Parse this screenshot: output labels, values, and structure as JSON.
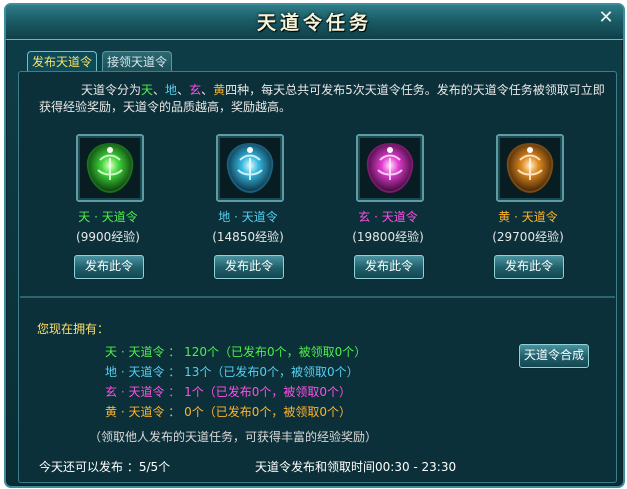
{
  "window": {
    "title": "天道令任务",
    "close_glyph": "✕"
  },
  "tabs": [
    {
      "label": "发布天道令",
      "active": true
    },
    {
      "label": "接领天道令",
      "active": false
    }
  ],
  "intro": {
    "lead": "天道令分为",
    "tian": "天",
    "sep1": "、",
    "di": "地",
    "sep2": "、",
    "xuan": "玄",
    "sep3": "、",
    "huang": "黄",
    "rest": "四种，每天总共可发布5次天道令任务。发布的天道令任务被领取可立即获得经验奖励，天道令的品质越高，奖励越高。"
  },
  "tokens": [
    {
      "name": "天 · 天道令",
      "exp": "(9900经验)",
      "button": "发布此令",
      "icon": "green-token-icon",
      "color": "#4cf04a"
    },
    {
      "name": "地 · 天道令",
      "exp": "(14850经验)",
      "button": "发布此令",
      "icon": "blue-token-icon",
      "color": "#55cff2"
    },
    {
      "name": "玄 · 天道令",
      "exp": "(19800经验)",
      "button": "发布此令",
      "icon": "magenta-token-icon",
      "color": "#ff4fe8"
    },
    {
      "name": "黄 · 天道令",
      "exp": "(29700经验)",
      "button": "发布此令",
      "icon": "orange-token-icon",
      "color": "#ffb42b"
    }
  ],
  "holdings": {
    "title": "您现在拥有：",
    "rows": [
      "天 · 天道令 ： 120个（已发布0个，被领取0个）",
      "地 · 天道令 ： 13个（已发布0个，被领取0个）",
      "玄 · 天道令 ： 1个（已发布0个，被领取0个）",
      "黄 · 天道令 ： 0个（已发布0个，被领取0个）"
    ],
    "merge_button": "天道令合成"
  },
  "note": "（领取他人发布的天道任务，可获得丰富的经验奖励）",
  "footer": {
    "remaining": "今天还可以发布 ：5/5个",
    "time": "天道令发布和领取时间00:30 - 23:30"
  },
  "colors": {
    "tian": "#4cf04a",
    "di": "#55cff2",
    "xuan": "#ff4fe8",
    "huang": "#ffb42b",
    "gold": "#ffe066"
  }
}
